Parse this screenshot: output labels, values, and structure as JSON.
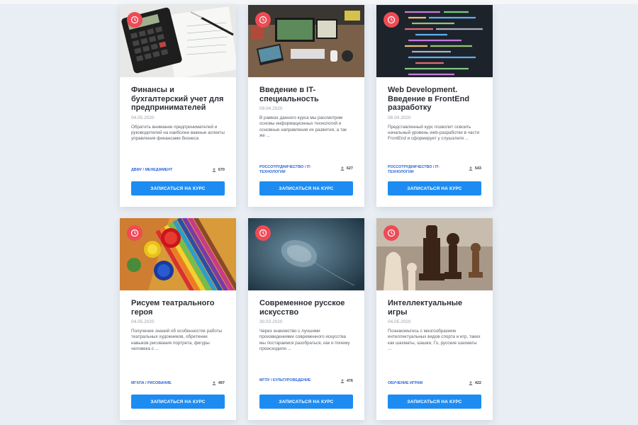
{
  "courses": [
    {
      "title": "Финансы и бухгалтерский учет для предпринимателей",
      "date": "04.05.2020",
      "description": "Обратить внимание предпринимателей и руководителей на наиболее важные аспекты управления финансами бизнеса",
      "tags": "ДВФУ / МЕНЕДЖМЕНТ",
      "count": "670",
      "button": "ЗАПИСАТЬСЯ НА КУРС",
      "image": "calculator-on-financial-papers"
    },
    {
      "title": "Введение в IT-специальность",
      "date": "09.04.2020",
      "description": "В рамках данного курса мы рассмотрим основы информационных технологий и основные направления их развития, а так же ...",
      "tags": "РОССОТРУДНИЧЕСТВО / IT-ТЕХНОЛОГИИ",
      "count": "627",
      "button": "ЗАПИСАТЬСЯ НА КУРС",
      "image": "desk-with-laptop-and-monitors"
    },
    {
      "title": "Web Development. Введение в FrontEnd разработку",
      "date": "08.04.2020",
      "description": "Представленный курс позволит освоить начальный уровень web-разработки в части FrontEnd и сформирует у слушателя ...",
      "tags": "РОССОТРУДНИЧЕСТВО / IT-ТЕХНОЛОГИИ",
      "count": "543",
      "button": "ЗАПИСАТЬСЯ НА КУРС",
      "image": "code-on-screen"
    },
    {
      "title": "Рисуем театрального героя",
      "date": "04.05.2020",
      "description": "Получение знаний об особенностях работы театральных художников, обретение навыков рисования портрета, фигуры человека с ...",
      "tags": "МГХПА / РИСОВАНИЕ",
      "count": "497",
      "button": "ЗАПИСАТЬСЯ НА КУРС",
      "image": "paints-and-color-pencils"
    },
    {
      "title": "Современное русское искусство",
      "date": "30.03.2020",
      "description": "Через знакомство с лучшими произведениями современного искусства мы постараемся разобраться, как и почему происходили ...",
      "tags": "МГПУ / КУЛЬТУРОВЕДЕНИЕ",
      "count": "476",
      "button": "ЗАПИСАТЬСЯ НА КУРС",
      "image": "abstract-blue-art"
    },
    {
      "title": "Интеллектуальные игры",
      "date": "04.05.2020",
      "description": "Познакомьтесь с многообразием интеллектуальных видов спорта и игр, таких как шахматы, шашки, Го, русские шахматы ...",
      "tags": "ОБУЧЕНИЕ ИГРАМ",
      "count": "422",
      "button": "ЗАПИСАТЬСЯ НА КУРС",
      "image": "chess-pieces"
    }
  ],
  "colors": {
    "accent": "#1d8cf2",
    "clock_badge": "#ee4b55",
    "tag": "#2b66d8",
    "page_bg": "#e9eef4"
  }
}
